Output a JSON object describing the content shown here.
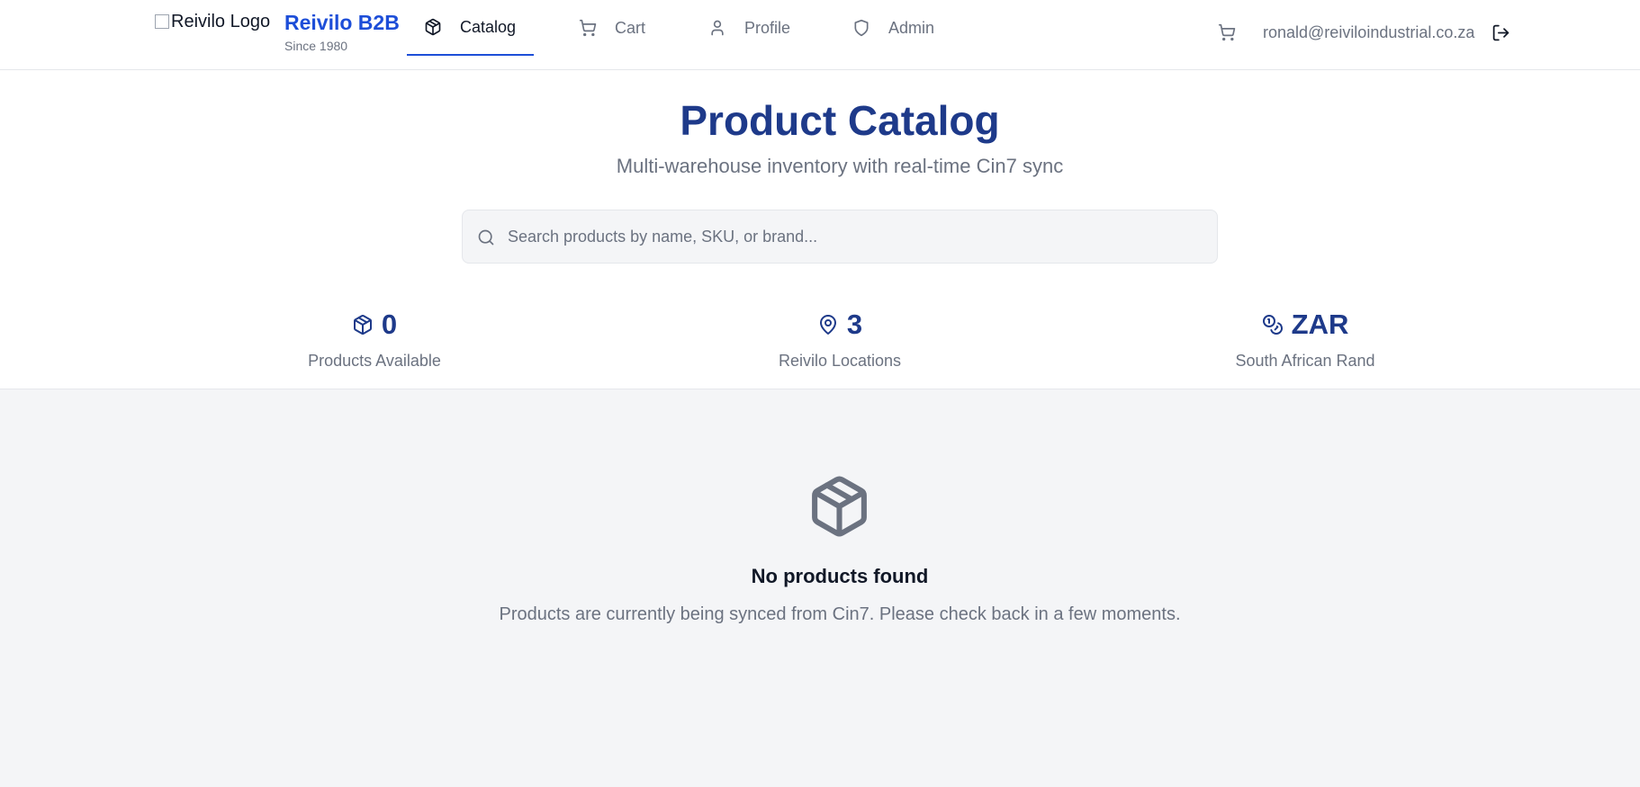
{
  "header": {
    "logo_alt": "Reivilo Logo",
    "brand_name": "Reivilo B2B",
    "brand_sub": "Since 1980",
    "nav": [
      {
        "label": "Catalog",
        "icon": "package-icon",
        "active": true
      },
      {
        "label": "Cart",
        "icon": "cart-icon",
        "active": false
      },
      {
        "label": "Profile",
        "icon": "user-icon",
        "active": false
      },
      {
        "label": "Admin",
        "icon": "shield-icon",
        "active": false
      }
    ],
    "user_email": "ronald@reiviloindustrial.co.za"
  },
  "hero": {
    "title": "Product Catalog",
    "subtitle": "Multi-warehouse inventory with real-time Cin7 sync",
    "search": {
      "placeholder": "Search products by name, SKU, or brand...",
      "value": ""
    }
  },
  "stats": [
    {
      "value": "0",
      "label": "Products Available",
      "icon": "package-icon"
    },
    {
      "value": "3",
      "label": "Reivilo Locations",
      "icon": "map-pin-icon"
    },
    {
      "value": "ZAR",
      "label": "South African Rand",
      "icon": "coins-icon"
    }
  ],
  "empty_state": {
    "title": "No products found",
    "message": "Products are currently being synced from Cin7. Please check back in a few moments."
  },
  "colors": {
    "brand_blue": "#1d4ed8",
    "heading_navy": "#1e3a8a",
    "muted_text": "#6b7280",
    "page_bg": "#f4f5f7"
  }
}
